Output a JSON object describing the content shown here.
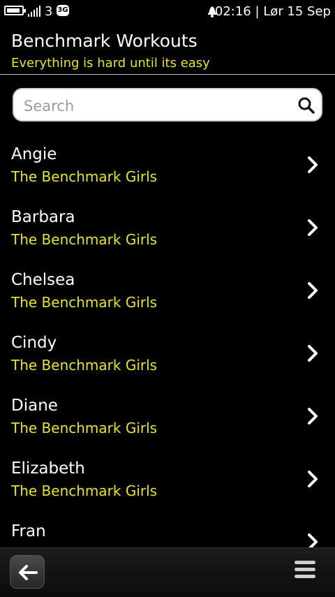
{
  "status": {
    "operator": "3",
    "network": "3G",
    "datetime": "02:16 | Lør 15 Sep"
  },
  "header": {
    "title": "Benchmark Workouts",
    "subtitle": "Everything is hard until its easy"
  },
  "search": {
    "placeholder": "Search",
    "value": ""
  },
  "list": [
    {
      "name": "Angie",
      "category": "The Benchmark Girls"
    },
    {
      "name": "Barbara",
      "category": "The Benchmark Girls"
    },
    {
      "name": "Chelsea",
      "category": "The Benchmark Girls"
    },
    {
      "name": "Cindy",
      "category": "The Benchmark Girls"
    },
    {
      "name": "Diane",
      "category": "The Benchmark Girls"
    },
    {
      "name": "Elizabeth",
      "category": "The Benchmark Girls"
    },
    {
      "name": "Fran",
      "category": ""
    }
  ],
  "colors": {
    "accent": "#e7e427",
    "background": "#000000",
    "text": "#ffffff"
  },
  "icons": {
    "search": "search-icon",
    "chevron": "chevron-right-icon",
    "back": "back-arrow-icon",
    "menu": "menu-icon"
  }
}
